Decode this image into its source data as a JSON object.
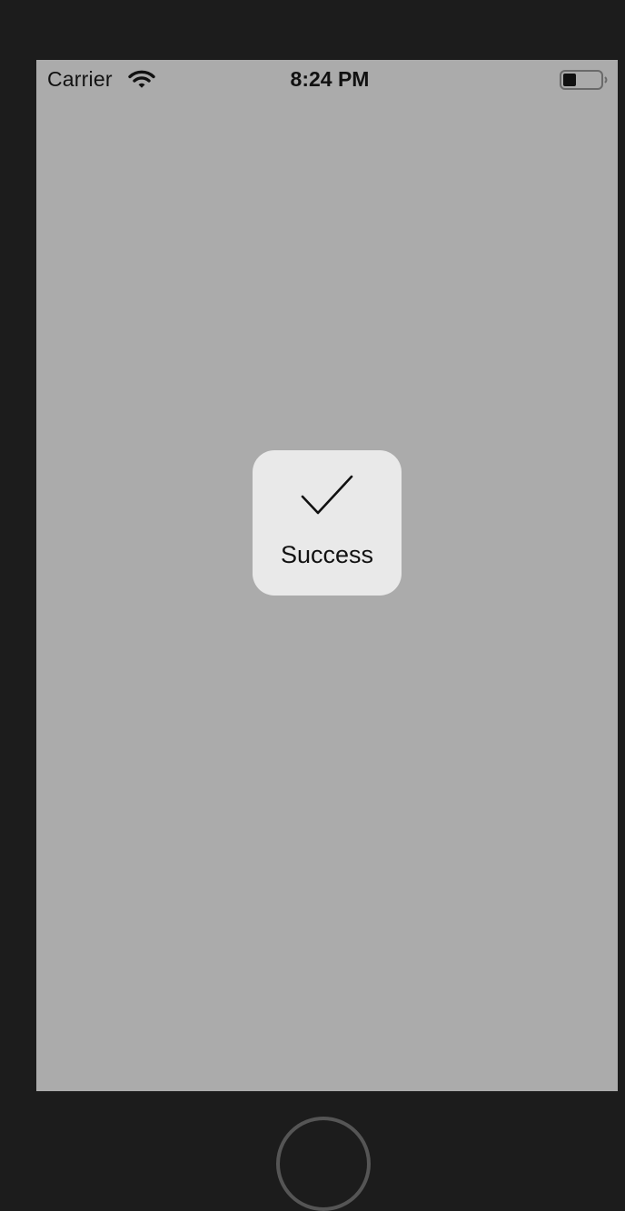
{
  "status_bar": {
    "carrier": "Carrier",
    "wifi_icon": "wifi-icon",
    "time": "8:24 PM",
    "battery_icon": "battery-icon",
    "battery_level": 0.35
  },
  "hud": {
    "icon": "checkmark-icon",
    "label": "Success"
  },
  "colors": {
    "device_frame": "#1c1c1c",
    "screen_background": "#ababab",
    "hud_background": "#e9e9e9",
    "text": "#111111"
  }
}
